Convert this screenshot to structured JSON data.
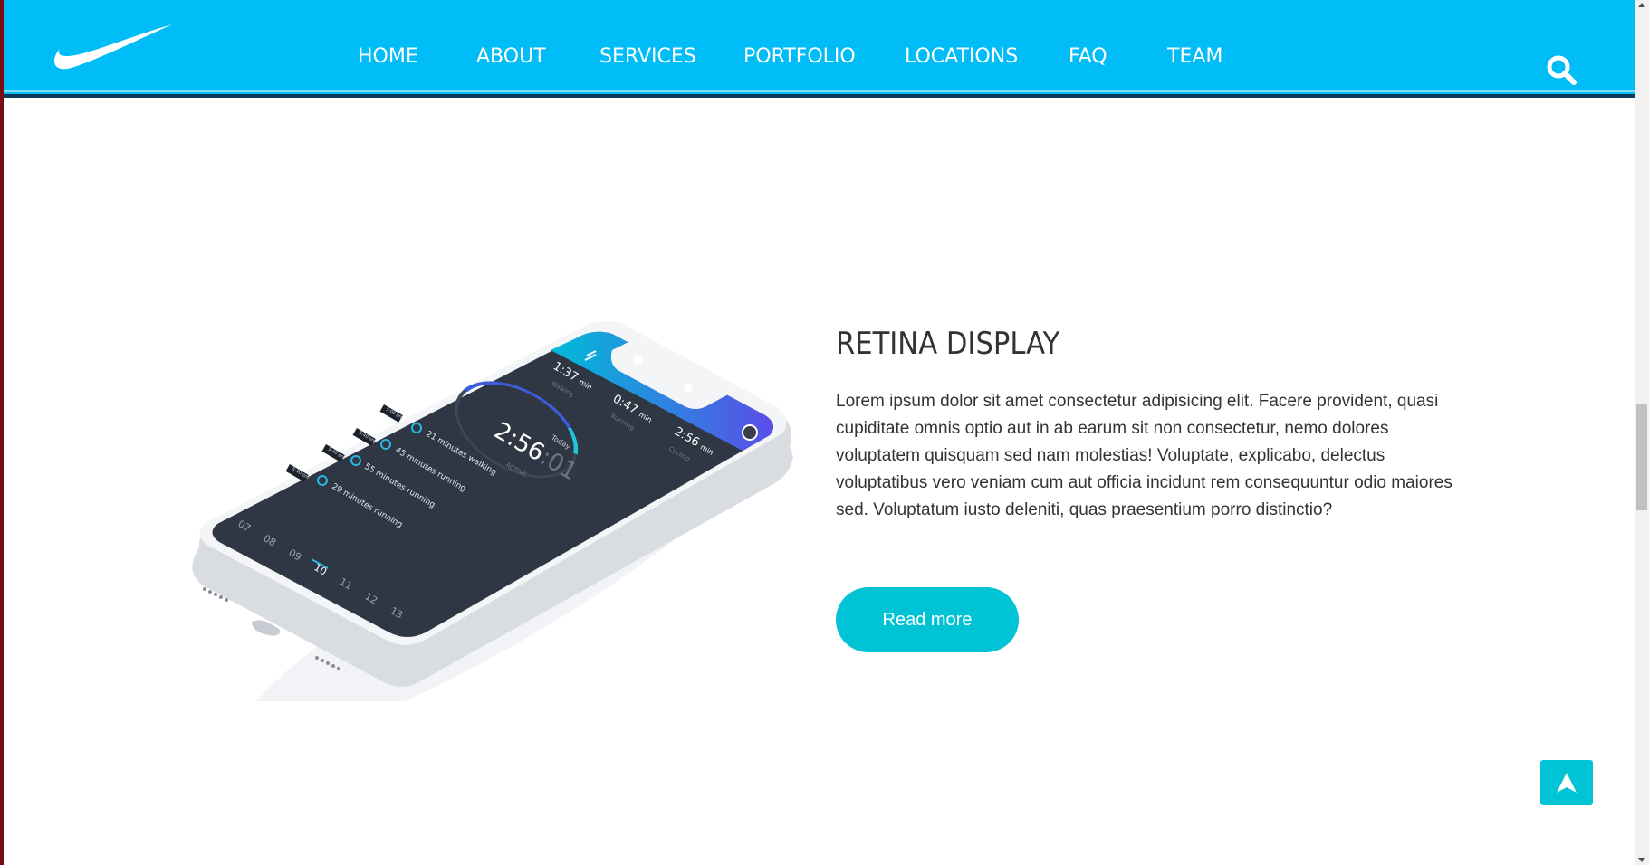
{
  "nav": {
    "items": [
      "HOME",
      "ABOUT",
      "SERVICES",
      "PORTFOLIO",
      "LOCATIONS",
      "FAQ",
      "TEAM"
    ]
  },
  "phone_screen": {
    "stats": [
      {
        "value": "1:37",
        "unit": "min",
        "label": "Walking"
      },
      {
        "value": "0:47",
        "unit": "min",
        "label": "Running"
      },
      {
        "value": "2:56",
        "unit": "min",
        "label": "Cycling"
      }
    ],
    "dial_day": "Today",
    "dial_time": "2:56",
    "dial_seconds": ":01",
    "dial_label": "ACTIVE",
    "activities": [
      {
        "time": "5:00 pm",
        "text": "21 minutes walking"
      },
      {
        "time": "5:40 pm",
        "text": "45 minutes running"
      },
      {
        "time": "5:40 pm",
        "text": "55 minutes running"
      },
      {
        "time": "5:40 pm",
        "text": "29 minutes running"
      }
    ],
    "days": [
      "07",
      "08",
      "09",
      "10",
      "11",
      "12",
      "13"
    ]
  },
  "feature": {
    "title": "RETINA DISPLAY",
    "body": "Lorem ipsum dolor sit amet consectetur adipisicing elit. Facere provident, quasi cupiditate omnis optio aut in ab earum sit non consectetur, nemo dolores voluptatem quisquam sed nam molestias! Voluptate, explicabo, delectus voluptatibus vero veniam cum aut officia incidunt rem consequuntur odio maiores sed. Voluptatum iusto deleniti, quas praesentium porro distinctio?",
    "button_label": "Read more"
  },
  "colors": {
    "navbar": "#00bdf7",
    "accent": "#00c3d6",
    "text": "#333333"
  },
  "icons": {
    "logo": "swoosh-logo",
    "search": "search-icon",
    "back_to_top": "arrow-up-icon"
  }
}
